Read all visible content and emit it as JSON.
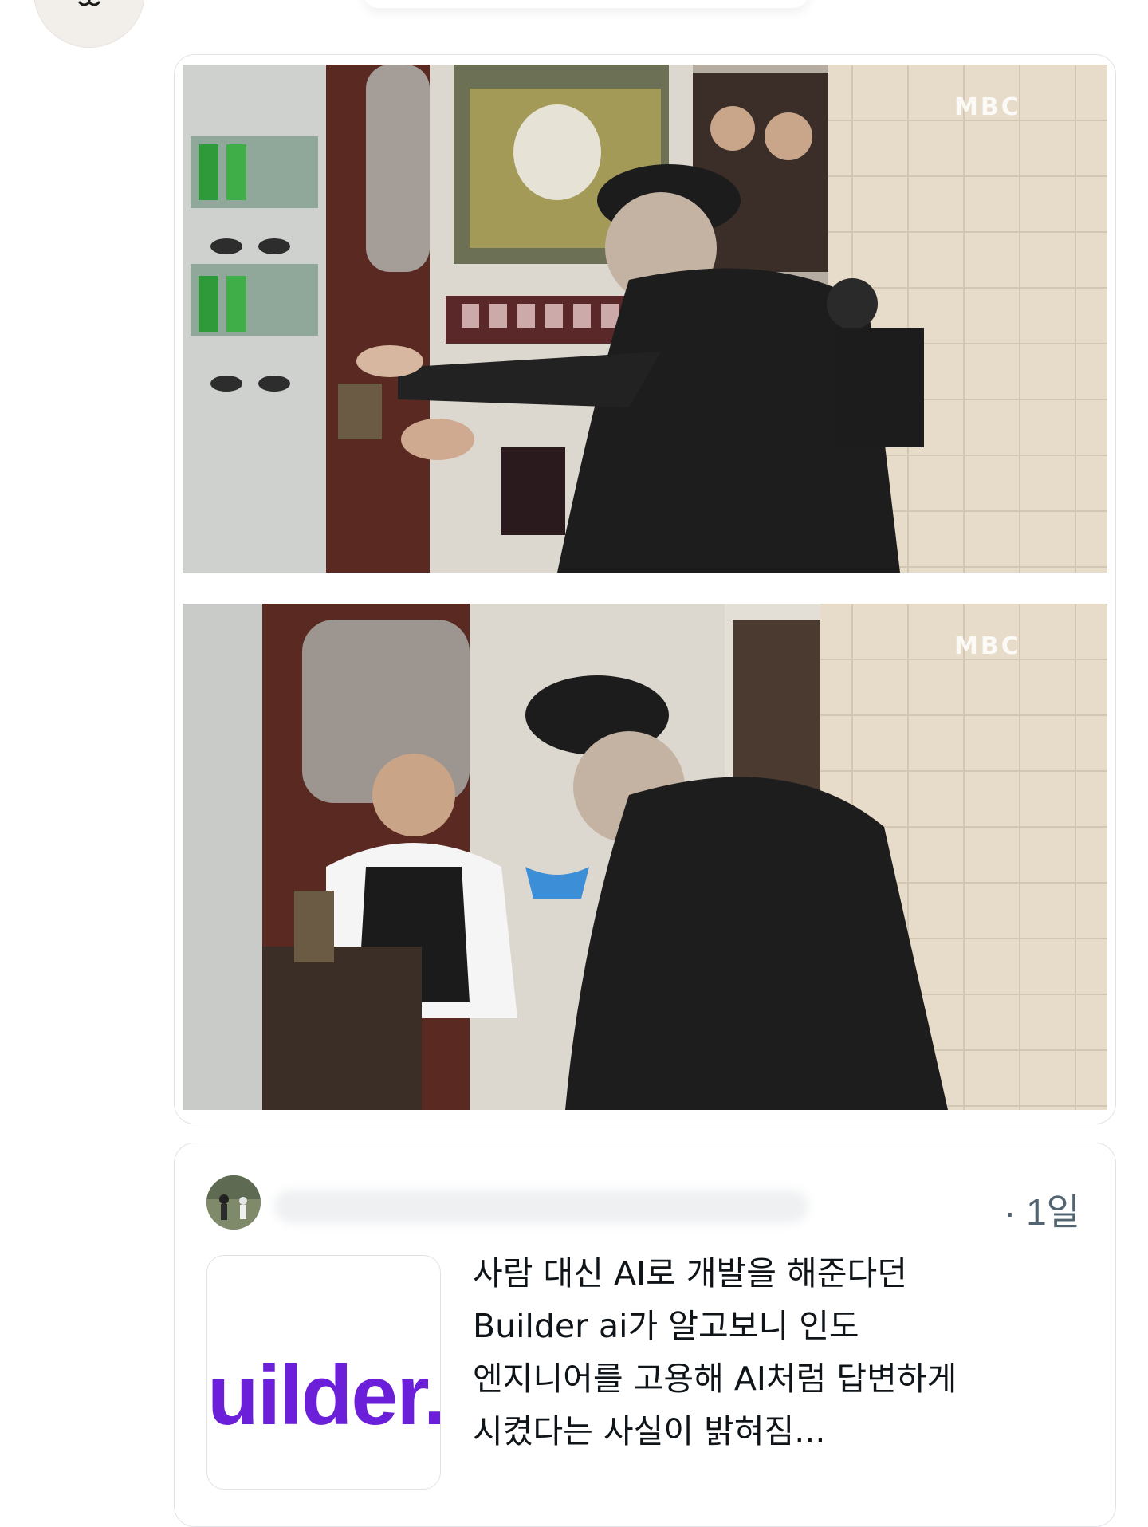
{
  "top_overlay": {
    "avatar_icon": "bear-face-icon"
  },
  "media": {
    "photos": [
      {
        "watermark": "MBC",
        "alt_icon": "photo-icon"
      },
      {
        "watermark": "MBC",
        "alt_icon": "photo-icon"
      }
    ]
  },
  "quote": {
    "time": "· 1일",
    "thumbnail_logo": "uilder.",
    "text": "사람 대신 AI로 개발을 해준다던\nBuilder ai가 알고보니 인도\n엔지니어를 고용해 AI처럼 답변하게\n시켰다는 사실이 밝혀짐..."
  },
  "colors": {
    "accent_purple": "#6c1fd9",
    "text_primary": "#0f1419",
    "text_secondary": "#536471",
    "border": "#dfe3e8"
  }
}
